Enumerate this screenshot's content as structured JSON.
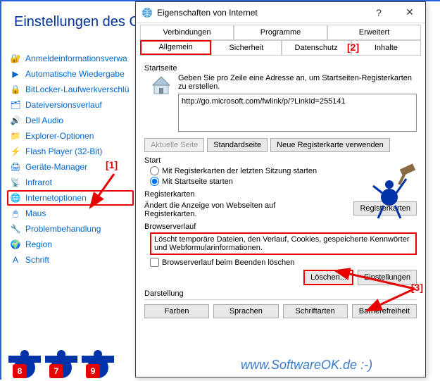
{
  "bg": {
    "title": "Einstellungen des Com"
  },
  "sidebar": {
    "items": [
      {
        "label": "Anmeldeinformationsverwa",
        "icon": "🔐"
      },
      {
        "label": "Automatische Wiedergabe",
        "icon": "▶"
      },
      {
        "label": "BitLocker-Laufwerkverschlü",
        "icon": "🔒"
      },
      {
        "label": "Dateiversionsverlauf",
        "icon": "🗂"
      },
      {
        "label": "Dell Audio",
        "icon": "🔊"
      },
      {
        "label": "Explorer-Optionen",
        "icon": "📁"
      },
      {
        "label": "Flash Player (32-Bit)",
        "icon": "⚡"
      },
      {
        "label": "Geräte-Manager",
        "icon": "🖨"
      },
      {
        "label": "Infrarot",
        "icon": "📡"
      },
      {
        "label": "Internetoptionen",
        "icon": "🌐"
      },
      {
        "label": "Maus",
        "icon": "🖱"
      },
      {
        "label": "Problembehandlung",
        "icon": "🔧"
      },
      {
        "label": "Region",
        "icon": "🌍"
      },
      {
        "label": "Schrift",
        "icon": "A"
      }
    ]
  },
  "annotations": {
    "a1": "[1]",
    "a2": "[2]",
    "a3": "[3]"
  },
  "dialog": {
    "title": "Eigenschaften von Internet",
    "tabs_row1": [
      "Verbindungen",
      "Programme",
      "Erweitert"
    ],
    "tabs_row2": [
      "Allgemein",
      "Sicherheit",
      "Datenschutz",
      "Inhalte"
    ],
    "startpage": {
      "label": "Startseite",
      "desc": "Geben Sie pro Zeile eine Adresse an, um Startseiten-Registerkarten zu erstellen.",
      "url": "http://go.microsoft.com/fwlink/p/?LinkId=255141"
    },
    "buttons": {
      "current": "Aktuelle Seite",
      "standard": "Standardseite",
      "newtab": "Neue Registerkarte verwenden"
    },
    "start": {
      "label": "Start",
      "opt1": "Mit Registerkarten der letzten Sitzung starten",
      "opt2": "Mit Startseite starten"
    },
    "tabs_section": {
      "label": "Registerkarten",
      "desc": "Ändert die Anzeige von Webseiten auf Registerkarten.",
      "btn": "Registerkarten"
    },
    "history": {
      "label": "Browserverlauf",
      "desc": "Löscht temporäre Dateien, den Verlauf, Cookies, gespeicherte Kennwörter und Webformularinformationen.",
      "check": "Browserverlauf beim Beenden löschen",
      "delete": "Löschen...",
      "settings": "Einstellungen"
    },
    "appearance": {
      "label": "Darstellung",
      "colors": "Farben",
      "langs": "Sprachen",
      "fonts": "Schriftarten",
      "access": "Barrierefreiheit"
    }
  },
  "watermark": "www.SoftwareOK.de :-)",
  "chars": {
    "c1": "8",
    "c2": "7",
    "c3": "9"
  }
}
